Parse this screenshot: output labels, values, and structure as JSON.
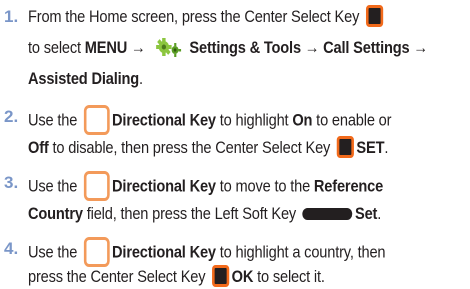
{
  "steps": [
    {
      "number": "1.",
      "lines": [
        {
          "t1": "From the Home screen, press the Center Select Key"
        },
        {
          "t1": "to select ",
          "b1": "MENU → ",
          "b2": " Settings & Tools → Call Settings →"
        },
        {
          "b1": "Assisted Dialing",
          "t2": "."
        }
      ]
    },
    {
      "number": "2.",
      "lines": [
        {
          "t1": "Use the ",
          "b1": "Directional Key",
          "t2": " to highlight ",
          "b2": "On",
          "t3": " to enable or"
        },
        {
          "b1": "Off",
          "t1": " to disable, then press the Center Select Key ",
          "b2": "SET",
          "t2": "."
        }
      ]
    },
    {
      "number": "3.",
      "lines": [
        {
          "t1": "Use the ",
          "b1": "Directional Key",
          "t2": " to move to the ",
          "b2": "Reference"
        },
        {
          "b1": "Country",
          "t1": " field, then press the Left Soft Key ",
          "b2": "Set",
          "t2": "."
        }
      ]
    },
    {
      "number": "4.",
      "lines": [
        {
          "t1": "Use the ",
          "b1": "Directional Key",
          "t2": " to highlight a country, then"
        },
        {
          "t1": "press the Center Select Key ",
          "b1": "OK",
          "t2": " to select it."
        }
      ]
    }
  ],
  "colors": {
    "number": "#7a96c8",
    "key_orange": "#f26a1b",
    "key_black": "#231f20"
  }
}
